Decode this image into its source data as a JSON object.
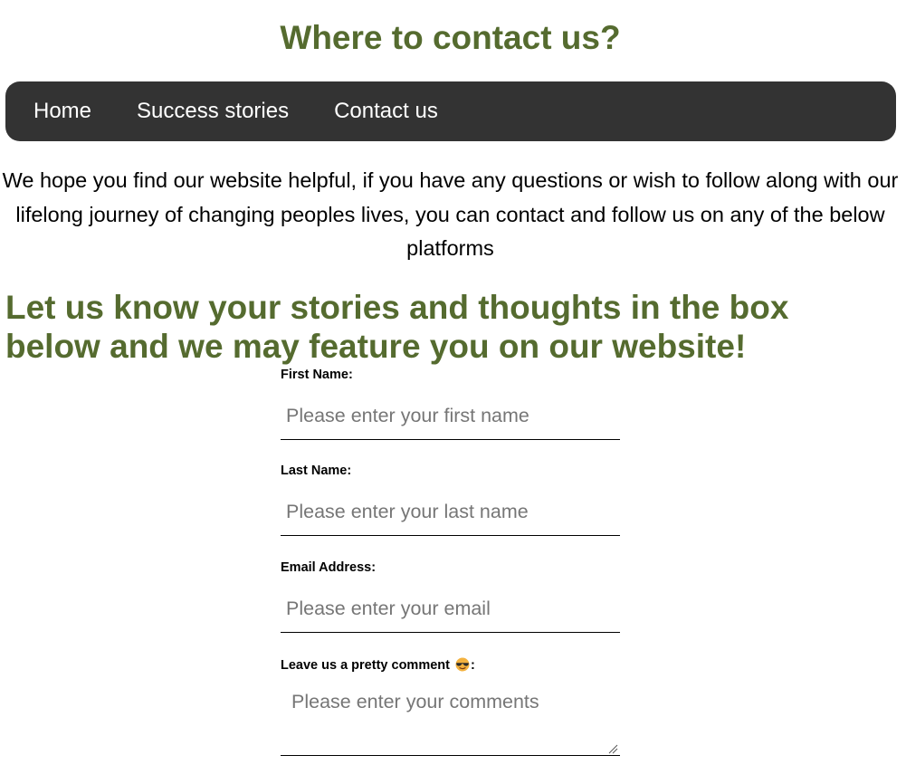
{
  "page": {
    "title": "Where to contact us?"
  },
  "nav": {
    "items": [
      {
        "label": "Home"
      },
      {
        "label": "Success stories"
      },
      {
        "label": "Contact us"
      }
    ]
  },
  "intro": {
    "text": "We hope you find our website helpful, if you have any questions or wish to follow along with our lifelong journey of changing peoples lives, you can contact and follow us on any of the below platforms"
  },
  "cta": {
    "heading": "Let us know your stories and thoughts in the box below and we may feature you on our website!"
  },
  "form": {
    "first_name": {
      "label": "First Name:",
      "placeholder": "Please enter your first name",
      "value": ""
    },
    "last_name": {
      "label": "Last Name:",
      "placeholder": "Please enter your last name",
      "value": ""
    },
    "email": {
      "label": "Email Address:",
      "placeholder": "Please enter your email",
      "value": ""
    },
    "comment": {
      "label_prefix": "Leave us a pretty comment",
      "label_icon": "sunglasses-emoji-icon",
      "label_suffix": ":",
      "placeholder": "Please enter your comments",
      "value": ""
    }
  },
  "colors": {
    "heading": "#556b2f",
    "navbar_bg": "#333333",
    "nav_text": "#ffffff",
    "placeholder": "#767676"
  }
}
